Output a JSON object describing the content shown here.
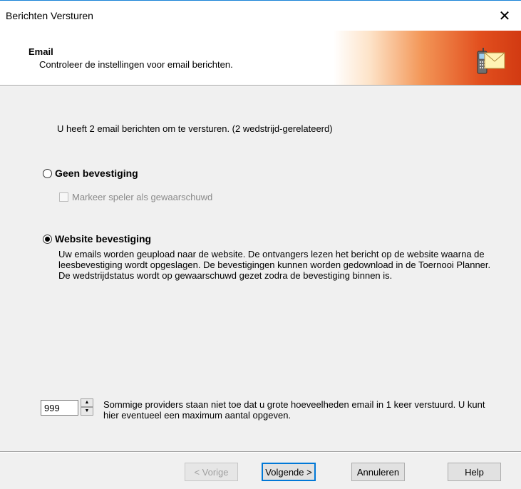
{
  "window": {
    "title": "Berichten Versturen",
    "close_glyph": "✕"
  },
  "header": {
    "title": "Email",
    "subtitle": "Controleer de instellingen voor email berichten.",
    "icon": "phone-email-icon"
  },
  "info": "U heeft 2 email berichten om te versturen. (2 wedstrijd-gerelateerd)",
  "options": {
    "geen": {
      "label": "Geen bevestiging",
      "checked": false
    },
    "markeer": {
      "label": "Markeer speler als gewaarschuwd",
      "checked": false,
      "enabled": false
    },
    "website": {
      "label": "Website bevestiging",
      "checked": true,
      "description": "Uw emails worden geupload naar de website. De ontvangers lezen het bericht op de website waarna de leesbevestiging wordt opgeslagen. De bevestigingen kunnen worden gedownload in de Toernooi Planner. De wedstrijdstatus wordt op gewaarschuwd gezet zodra de bevestiging binnen is."
    }
  },
  "limit": {
    "value": "999",
    "note": "Sommige providers staan niet toe dat u grote hoeveelheden email in 1 keer verstuurd. U kunt hier eventueel een maximum aantal opgeven."
  },
  "buttons": {
    "back": "< Vorige",
    "next": "Volgende >",
    "cancel": "Annuleren",
    "help": "Help"
  }
}
